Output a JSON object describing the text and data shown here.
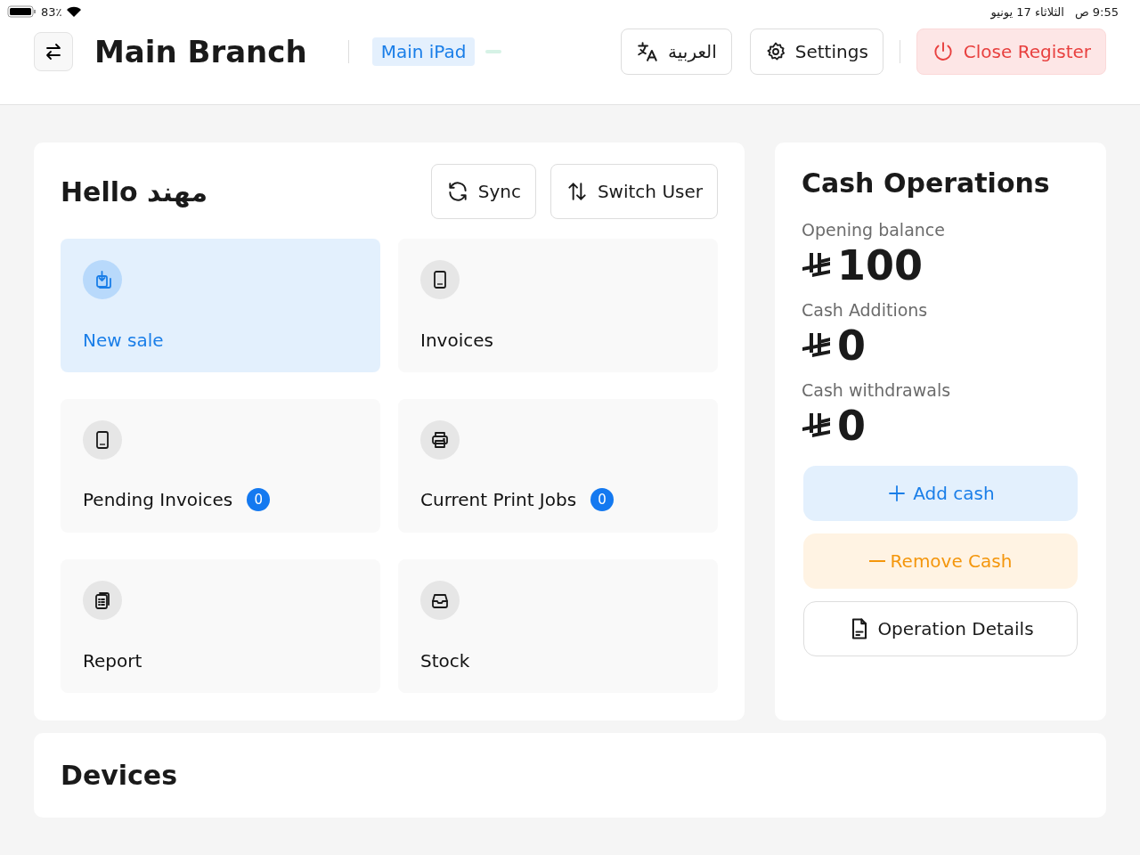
{
  "status_bar": {
    "battery": "83٪",
    "time": "9:55 ص",
    "date": "الثلاثاء 17 يونيو"
  },
  "header": {
    "branch": "Main Branch",
    "device": "Main iPad",
    "language_button": "العربية",
    "settings_button": "Settings",
    "close_button": "Close Register"
  },
  "main": {
    "greeting": "Hello مهند",
    "sync_button": "Sync",
    "switch_user_button": "Switch User",
    "tiles": [
      {
        "kind": "sale",
        "label": "New sale",
        "selected": true
      },
      {
        "kind": "tablet",
        "label": "Invoices",
        "selected": false
      },
      {
        "kind": "tablet",
        "label": "Pending Invoices",
        "selected": false,
        "count": "0"
      },
      {
        "kind": "printer",
        "label": "Current Print Jobs",
        "selected": false,
        "count": "0"
      },
      {
        "kind": "clipboard",
        "label": "Report",
        "selected": false
      },
      {
        "kind": "tray",
        "label": "Stock",
        "selected": false
      }
    ]
  },
  "cash": {
    "title": "Cash Operations",
    "items": [
      {
        "label": "Opening balance",
        "amount": "100"
      },
      {
        "label": "Cash Additions",
        "amount": "0"
      },
      {
        "label": "Cash withdrawals",
        "amount": "0"
      }
    ],
    "add_button": "Add cash",
    "remove_button": "Remove Cash",
    "details_button": "Operation Details"
  },
  "devices": {
    "title": "Devices"
  }
}
